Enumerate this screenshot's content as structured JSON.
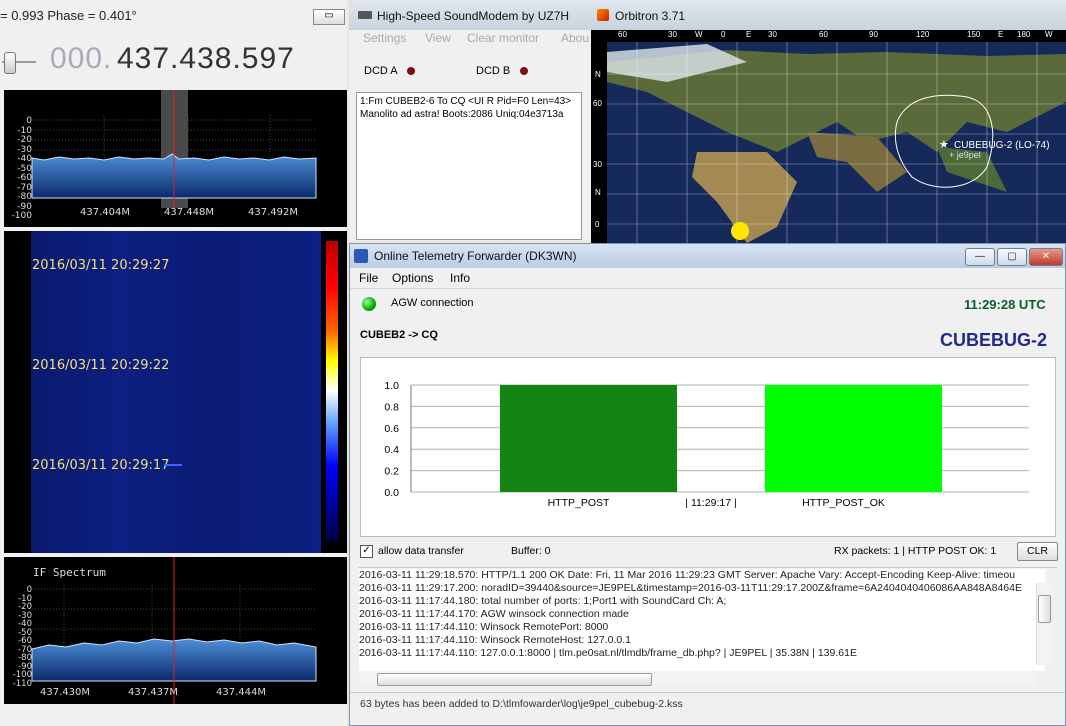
{
  "sdr": {
    "phase_text": "= 0.993 Phase = 0.401°",
    "min_button": "▭",
    "freq_lead": "000.",
    "freq_main": "437.438.597",
    "spectrum_top": {
      "y_labels": [
        "0",
        "-10",
        "-20",
        "-30",
        "-40",
        "-50",
        "-60",
        "-70",
        "-80",
        "-90",
        "-100"
      ],
      "x_labels": [
        "437.404M",
        "437.448M",
        "437.492M"
      ]
    },
    "waterfall": {
      "timestamps": [
        "2016/03/11 20:29:27",
        "2016/03/11 20:29:22",
        "2016/03/11 20:29:17"
      ]
    },
    "if_spectrum": {
      "title": "IF Spectrum",
      "y_labels": [
        "0",
        "-10",
        "-20",
        "-30",
        "-40",
        "-50",
        "-60",
        "-70",
        "-80",
        "-90",
        "-100",
        "-110"
      ],
      "x_labels": [
        "437.430M",
        "437.437M",
        "437.444M"
      ]
    }
  },
  "soundmodem": {
    "title": "High-Speed SoundModem by UZ7H",
    "menu": [
      "Settings",
      "View",
      "Clear monitor",
      "Abou"
    ],
    "dcd_a": "DCD A",
    "dcd_b": "DCD B",
    "monitor_line1": "1:Fm CUBEB2-6 To CQ <UI R Pid=F0 Len=43>",
    "monitor_line2": "Manolito ad astra! Boots:2086 Uniq:04e3713a"
  },
  "orbitron": {
    "title": "Orbitron 3.71",
    "top_labels": [
      "60",
      "30",
      "W",
      "0",
      "E",
      "30",
      "60",
      "90",
      "120",
      "150",
      "E",
      "180",
      "W"
    ],
    "side_labels": [
      "N",
      "60",
      "30",
      "N",
      "0"
    ],
    "satellite_label": "CUBEBUG-2 (LO-74)",
    "station_label": "je9pel"
  },
  "otf": {
    "title": "Online Telemetry Forwarder (DK3WN)",
    "menu": [
      "File",
      "Options",
      "Info"
    ],
    "agw_label": "AGW connection",
    "time": "11:29:28 UTC",
    "path": "CUBEB2 -> CQ",
    "satellite": "CUBEBUG-2",
    "allow_label": "allow data transfer",
    "buffer": "Buffer: 0",
    "rx_packets": "RX packets: 1 | HTTP POST OK: 1",
    "clr_button": "CLR",
    "status_bar": "63 bytes has been added to D:\\tlmfowarder\\log\\je9pel_cubebug-2.kss",
    "log": [
      "2016-03-11 11:29:18.570: HTTP/1.1 200 OK Date: Fri, 11 Mar 2016 11:29:23 GMT Server: Apache Vary: Accept-Encoding Keep-Alive: timeou",
      "2016-03-11 11:29:17.200: noradID=39440&source=JE9PEL&timestamp=2016-03-11T11:29:17.200Z&frame=6A2404040406086AA848A8464E",
      "2016-03-11 11:17:44.180: total number of ports: 1;Port1 with SoundCard Ch: A;",
      "2016-03-11 11:17:44.170: AGW winsock connection made",
      "2016-03-11 11:17:44.110: Winsock RemotePort: 8000",
      "2016-03-11 11:17:44.110: Winsock RemoteHost: 127.0.0.1",
      "2016-03-11 11:17:44.110: 127.0.0.1:8000 | tlm.pe0sat.nl/tlmdb/frame_db.php? | JE9PEL | 35.38N | 139.61E"
    ],
    "colors": {
      "accent": "#1f2a8c",
      "time": "#0d5a2b",
      "bar1": "#128512",
      "bar2": "#00ff00"
    }
  },
  "chart_data": {
    "type": "bar",
    "categories": [
      "HTTP_POST",
      "HTTP_POST_OK"
    ],
    "values": [
      1.0,
      1.0
    ],
    "center_label": "| 11:29:17 |",
    "y_ticks": [
      "1.0",
      "0.8",
      "0.6",
      "0.4",
      "0.2",
      "0.0"
    ],
    "ylim": [
      0,
      1
    ],
    "grid": true
  }
}
